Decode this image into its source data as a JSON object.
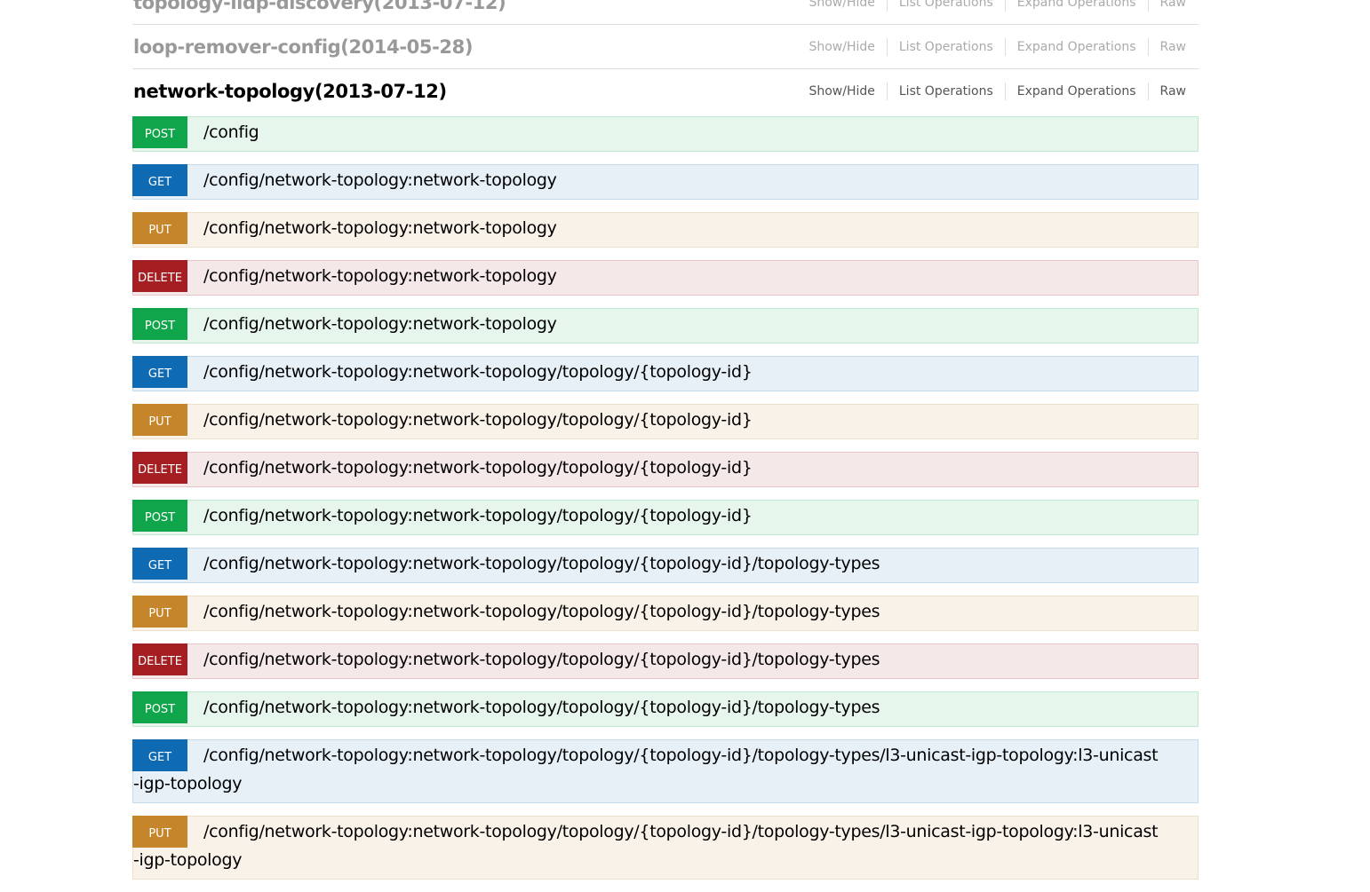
{
  "resources": [
    {
      "title": "topology-lldp-discovery(2013-07-12)",
      "options": [
        "Show/Hide",
        "List Operations",
        "Expand Operations",
        "Raw"
      ]
    },
    {
      "title": "loop-remover-config(2014-05-28)",
      "options": [
        "Show/Hide",
        "List Operations",
        "Expand Operations",
        "Raw"
      ]
    },
    {
      "title": "network-topology(2013-07-12)",
      "options": [
        "Show/Hide",
        "List Operations",
        "Expand Operations",
        "Raw"
      ]
    }
  ],
  "operations": [
    {
      "method": "POST",
      "path": "/config"
    },
    {
      "method": "GET",
      "path": "/config/network-topology:network-topology"
    },
    {
      "method": "PUT",
      "path": "/config/network-topology:network-topology"
    },
    {
      "method": "DELETE",
      "path": "/config/network-topology:network-topology"
    },
    {
      "method": "POST",
      "path": "/config/network-topology:network-topology"
    },
    {
      "method": "GET",
      "path": "/config/network-topology:network-topology/topology/{topology-id}"
    },
    {
      "method": "PUT",
      "path": "/config/network-topology:network-topology/topology/{topology-id}"
    },
    {
      "method": "DELETE",
      "path": "/config/network-topology:network-topology/topology/{topology-id}"
    },
    {
      "method": "POST",
      "path": "/config/network-topology:network-topology/topology/{topology-id}"
    },
    {
      "method": "GET",
      "path": "/config/network-topology:network-topology/topology/{topology-id}/topology-types"
    },
    {
      "method": "PUT",
      "path": "/config/network-topology:network-topology/topology/{topology-id}/topology-types"
    },
    {
      "method": "DELETE",
      "path": "/config/network-topology:network-topology/topology/{topology-id}/topology-types"
    },
    {
      "method": "POST",
      "path": "/config/network-topology:network-topology/topology/{topology-id}/topology-types"
    },
    {
      "method": "GET",
      "path": "/config/network-topology:network-topology/topology/{topology-id}/topology-types/l3-unicast-igp-topology:l3-unicast-igp-topology"
    },
    {
      "method": "PUT",
      "path": "/config/network-topology:network-topology/topology/{topology-id}/topology-types/l3-unicast-igp-topology:l3-unicast-igp-topology"
    }
  ],
  "colors": {
    "post": "#10a54a",
    "get": "#0f6ab4",
    "put": "#c5862b",
    "delete": "#a41e22"
  }
}
